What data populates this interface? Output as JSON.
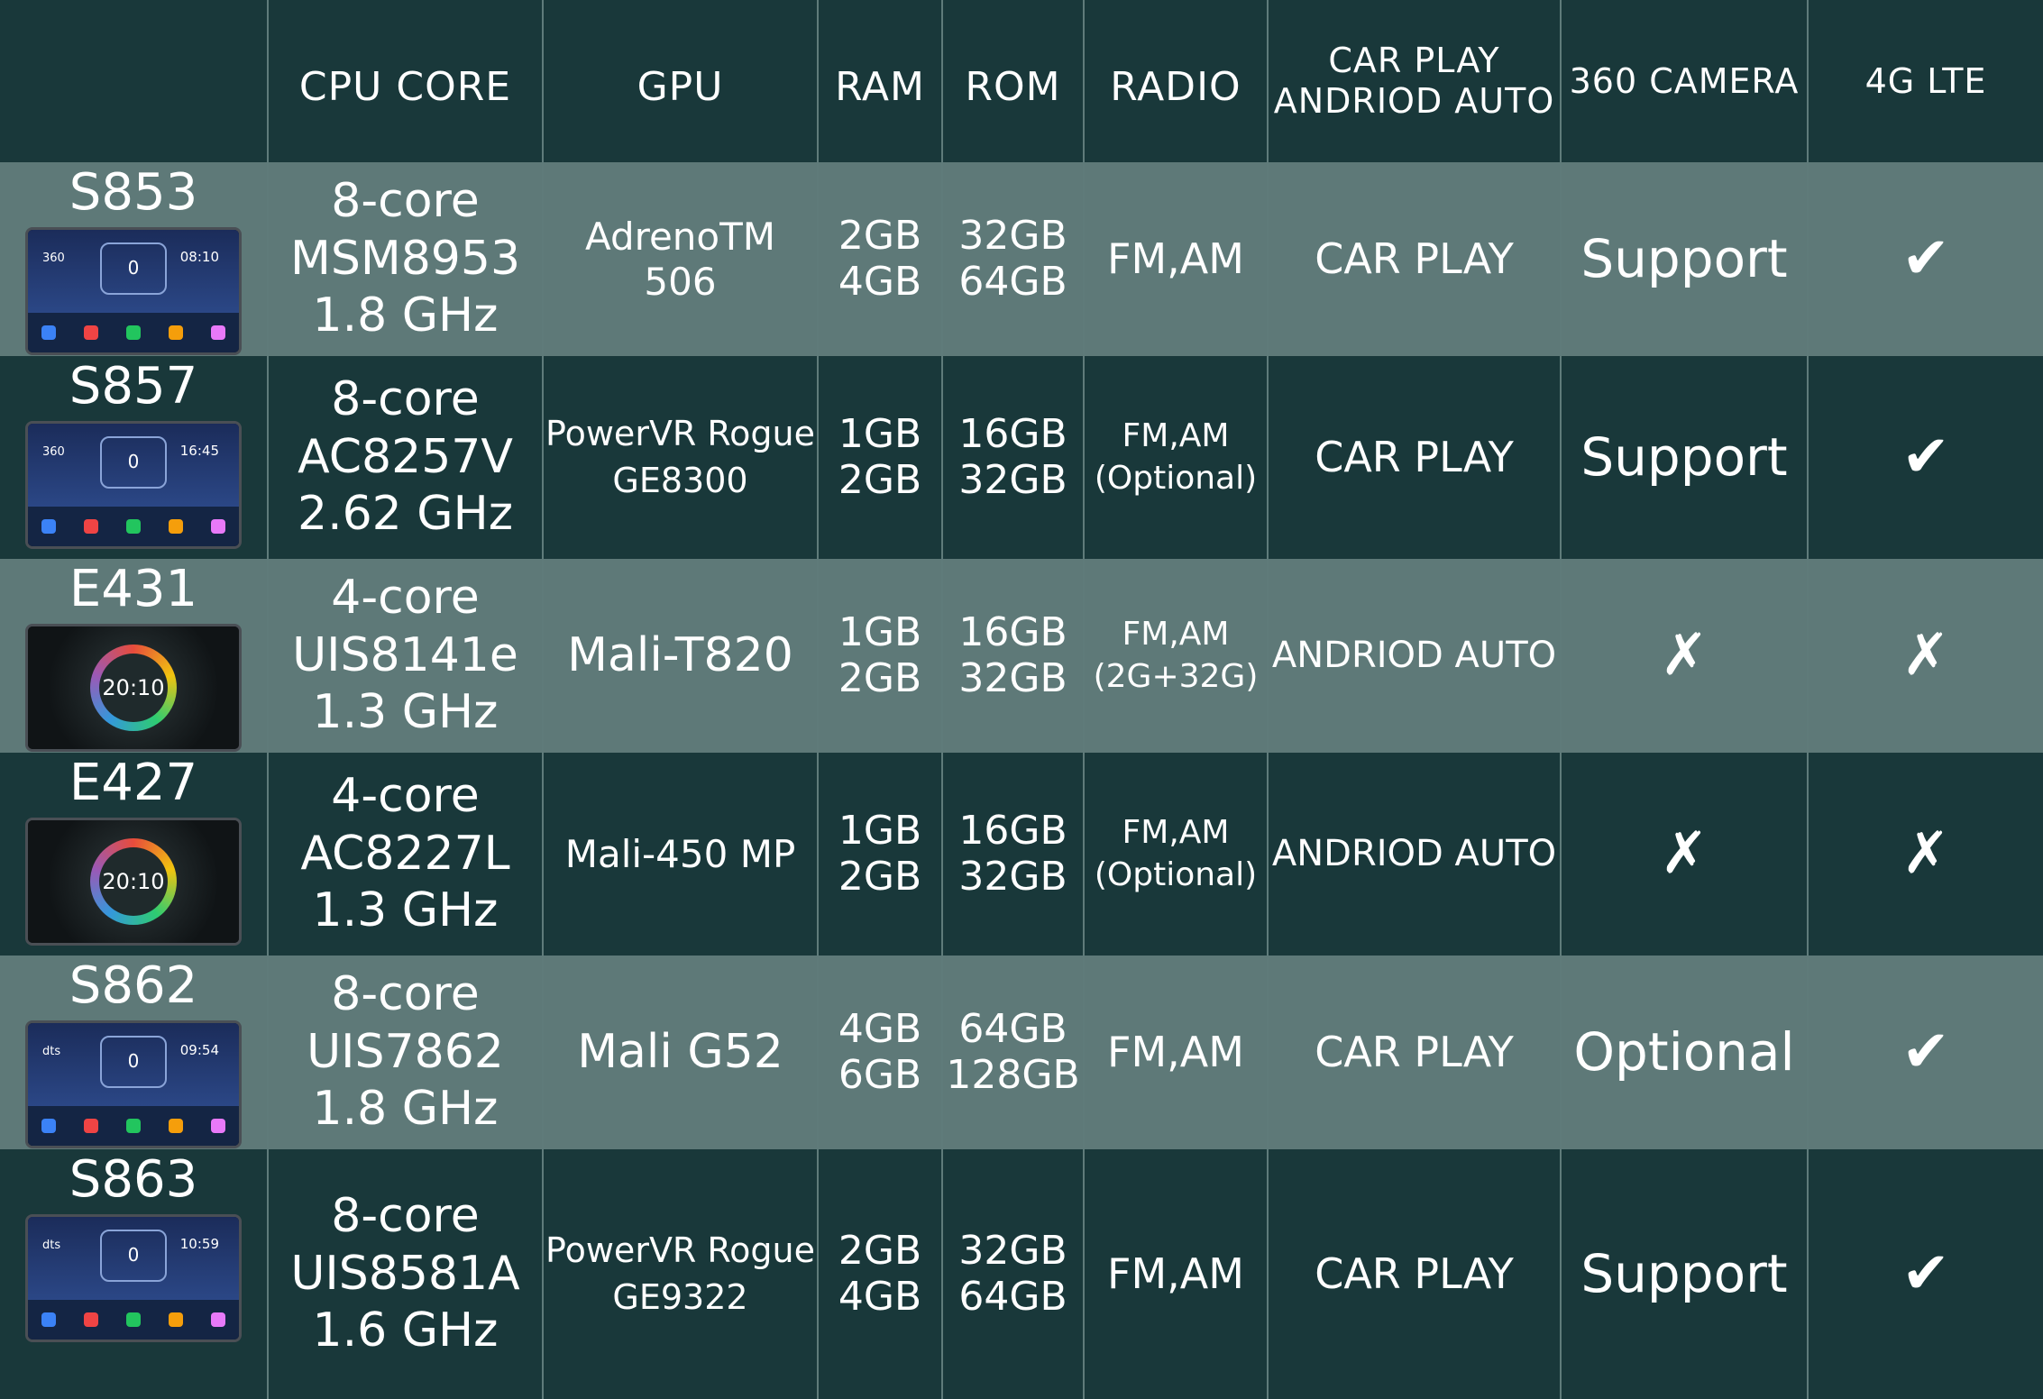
{
  "headers": [
    "",
    "CPU CORE",
    "GPU",
    "RAM",
    "ROM",
    "RADIO",
    "CAR PLAY\nANDRIOD AUTO",
    "360 CAMERA",
    "4G LTE"
  ],
  "rows": [
    {
      "model": "S853",
      "screen": {
        "style": "flat",
        "left": "360",
        "speed": "0",
        "clock": "08:10"
      },
      "cpu": [
        "8-core",
        "MSM8953",
        "1.8 GHz"
      ],
      "gpu": [
        "AdrenoTM 506"
      ],
      "ram": [
        "2GB",
        "4GB"
      ],
      "rom": [
        "32GB",
        "64GB"
      ],
      "radio": [
        "FM,AM"
      ],
      "carplay": "CAR PLAY",
      "camera": "Support",
      "lte": "✔"
    },
    {
      "model": "S857",
      "screen": {
        "style": "flat",
        "left": "360",
        "speed": "0",
        "clock": "16:45"
      },
      "cpu": [
        "8-core",
        "AC8257V",
        "2.62 GHz"
      ],
      "gpu": [
        "PowerVR Rogue",
        "GE8300"
      ],
      "ram": [
        "1GB",
        "2GB"
      ],
      "rom": [
        "16GB",
        "32GB"
      ],
      "radio": [
        "FM,AM",
        "(Optional)"
      ],
      "carplay": "CAR PLAY",
      "camera": "Support",
      "lte": "✔"
    },
    {
      "model": "E431",
      "screen": {
        "style": "round",
        "clock": "20:10"
      },
      "cpu": [
        "4-core",
        "UIS8141e",
        "1.3 GHz"
      ],
      "gpu": [
        "Mali-T820"
      ],
      "ram": [
        "1GB",
        "2GB"
      ],
      "rom": [
        "16GB",
        "32GB"
      ],
      "radio": [
        "FM,AM",
        "(2G+32G)"
      ],
      "carplay": "ANDRIOD AUTO",
      "camera": "✗",
      "lte": "✗"
    },
    {
      "model": "E427",
      "screen": {
        "style": "round",
        "clock": "20:10"
      },
      "cpu": [
        "4-core",
        "AC8227L",
        "1.3 GHz"
      ],
      "gpu": [
        "Mali-450 MP"
      ],
      "ram": [
        "1GB",
        "2GB"
      ],
      "rom": [
        "16GB",
        "32GB"
      ],
      "radio": [
        "FM,AM",
        "(Optional)"
      ],
      "carplay": "ANDRIOD AUTO",
      "camera": "✗",
      "lte": "✗"
    },
    {
      "model": "S862",
      "screen": {
        "style": "flat",
        "left": "dts",
        "speed": "0",
        "clock": "09:54"
      },
      "cpu": [
        "8-core",
        "UIS7862",
        "1.8 GHz"
      ],
      "gpu": [
        "Mali G52"
      ],
      "ram": [
        "4GB",
        "6GB"
      ],
      "rom": [
        "64GB",
        "128GB"
      ],
      "radio": [
        "FM,AM"
      ],
      "carplay": "CAR PLAY",
      "camera": "Optional",
      "lte": "✔"
    },
    {
      "model": "S863",
      "screen": {
        "style": "flat",
        "left": "dts",
        "speed": "0",
        "clock": "10:59"
      },
      "cpu": [
        "8-core",
        "UIS8581A",
        "1.6 GHz"
      ],
      "gpu": [
        "PowerVR Rogue",
        "GE9322"
      ],
      "ram": [
        "2GB",
        "4GB"
      ],
      "rom": [
        "32GB",
        "64GB"
      ],
      "radio": [
        "FM,AM"
      ],
      "carplay": "CAR PLAY",
      "camera": "Support",
      "lte": "✔"
    }
  ],
  "colors": {
    "dark": "#19383a",
    "light": "#5e7978",
    "divider": "#5f7b7a"
  }
}
